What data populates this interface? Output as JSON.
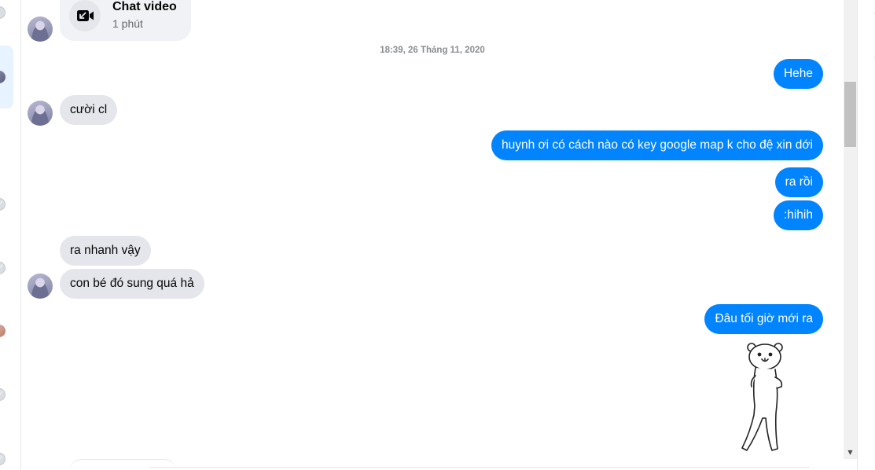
{
  "call": {
    "title": "Chat video",
    "duration": "1 phút",
    "icon": "video-call-icon"
  },
  "timestamp": "18:39, 26 Tháng 11, 2020",
  "messages": [
    {
      "side": "out",
      "text": "Hehe"
    },
    {
      "side": "in",
      "text": "cười cl"
    },
    {
      "side": "out",
      "text": "huynh ơi có cách nào có key google map k cho đệ xin dới"
    },
    {
      "side": "out",
      "text": "ra rồi"
    },
    {
      "side": "out",
      "text": ":hihih"
    },
    {
      "side": "in",
      "text": "ra nhanh vậy"
    },
    {
      "side": "in",
      "text": "con bé đó sung quá hả"
    },
    {
      "side": "out",
      "text": "Đâu tối giờ mới ra"
    }
  ],
  "sticker": {
    "icon": "bear-sticker"
  },
  "colors": {
    "outgoing": "#0084ff",
    "incoming": "#e4e6eb",
    "timestamp": "#8a8d91"
  }
}
